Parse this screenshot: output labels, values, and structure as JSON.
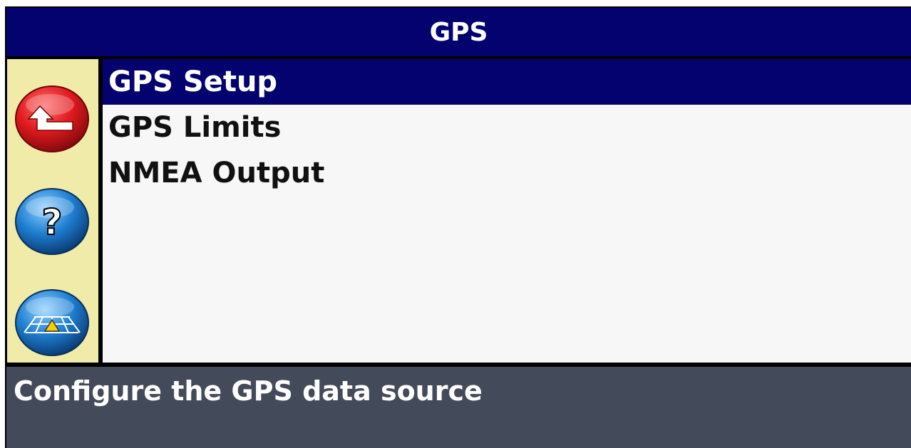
{
  "header": {
    "title": "GPS"
  },
  "sidebar": {
    "buttons": [
      {
        "name": "back-icon",
        "color": "#d9141c"
      },
      {
        "name": "help-icon",
        "color": "#1f7fd1"
      },
      {
        "name": "guidance-view-icon",
        "color": "#1f7fd1"
      }
    ]
  },
  "menu": {
    "items": [
      {
        "label": "GPS Setup",
        "selected": true
      },
      {
        "label": "GPS Limits",
        "selected": false
      },
      {
        "label": "NMEA Output",
        "selected": false
      }
    ]
  },
  "status": {
    "text": "Configure the GPS data source"
  },
  "colors": {
    "title_bg": "#03026e",
    "selection_bg": "#03026e",
    "sidebar_bg": "#f0eba8",
    "status_bg": "#434a5a"
  }
}
